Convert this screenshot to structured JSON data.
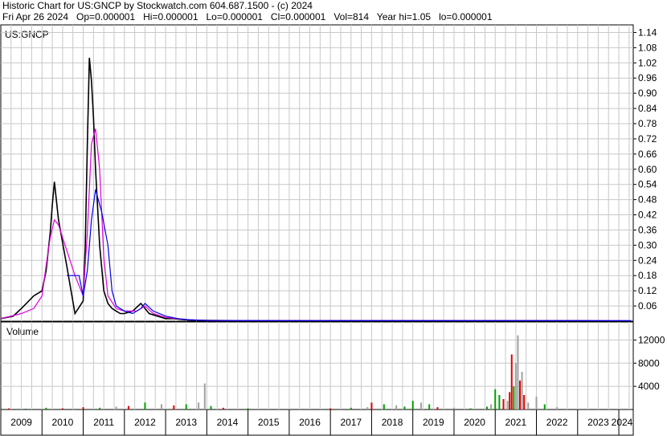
{
  "header": {
    "line1": "Historic Chart for US:GNCP by Stockwatch.com 604.687.1500 - (c) 2024",
    "line2": "Fri Apr 26 2024   Op=0.000001   Hi=0.000001   Lo=0.000001   Cl=0.000001   Vol=814   Year hi=1.05   lo=0.000001"
  },
  "colors": {
    "grid": "#c8c8c8",
    "price": "#000000",
    "down": "#e00000",
    "ma_short": "#e000e0",
    "ma_long": "#0000e0",
    "vol_up": "#00a000",
    "vol_down": "#e00000",
    "vol_flat": "#a0a0a0"
  },
  "chart_data": [
    {
      "type": "line",
      "title": "",
      "symbol_label": "US:GNCP",
      "ylim": [
        0,
        1.17
      ],
      "yticks": [
        "1.14",
        "1.08",
        "1.02",
        "0.96",
        "0.90",
        "0.84",
        "0.78",
        "0.72",
        "0.66",
        "0.60",
        "0.54",
        "0.48",
        "0.42",
        "0.36",
        "0.30",
        "0.24",
        "0.18",
        "0.12",
        "0.06"
      ],
      "x_years": [
        "2009",
        "2010",
        "2011",
        "2012",
        "2013",
        "2014",
        "2015",
        "2016",
        "2017",
        "2018",
        "2019",
        "2020",
        "2021",
        "2022",
        "2023",
        "2024"
      ],
      "series": [
        {
          "style": "price",
          "x": [
            2009.0,
            2009.3,
            2009.5,
            2009.8,
            2010.0,
            2010.1,
            2010.2,
            2010.25,
            2010.3,
            2010.4,
            2010.6,
            2010.8,
            2011.0,
            2011.05,
            2011.1,
            2011.15,
            2011.2,
            2011.25,
            2011.3,
            2011.4,
            2011.5,
            2011.6,
            2011.7,
            2011.8,
            2011.9,
            2012.0,
            2012.2,
            2012.4,
            2012.6,
            2012.8,
            2013.0,
            2013.2,
            2013.5,
            2014.0,
            2015.0,
            2016.0,
            2017.0,
            2018.0,
            2019.0,
            2020.0,
            2021.0,
            2021.5,
            2022.0,
            2023.0,
            2024.3
          ],
          "y": [
            0.01,
            0.02,
            0.05,
            0.1,
            0.12,
            0.2,
            0.35,
            0.46,
            0.55,
            0.4,
            0.22,
            0.03,
            0.08,
            0.3,
            0.7,
            1.04,
            0.95,
            0.8,
            0.6,
            0.3,
            0.12,
            0.07,
            0.05,
            0.04,
            0.03,
            0.03,
            0.04,
            0.07,
            0.03,
            0.02,
            0.01,
            0.01,
            0.005,
            0.003,
            0.002,
            0.002,
            0.002,
            0.002,
            0.002,
            0.002,
            0.002,
            0.002,
            0.002,
            0.002,
            1e-06
          ]
        },
        {
          "style": "ma_short",
          "x": [
            2009.0,
            2009.5,
            2009.8,
            2010.0,
            2010.1,
            2010.2,
            2010.3,
            2010.4,
            2010.6,
            2010.8,
            2011.0,
            2011.1,
            2011.2,
            2011.3,
            2011.4,
            2011.5,
            2011.6,
            2011.8,
            2012.0,
            2012.3,
            2012.5,
            2012.7,
            2013.0,
            2013.5,
            2014.0,
            2016.0,
            2020.0,
            2024.3
          ],
          "y": [
            0.01,
            0.03,
            0.05,
            0.1,
            0.22,
            0.33,
            0.4,
            0.38,
            0.28,
            0.18,
            0.1,
            0.35,
            0.7,
            0.76,
            0.6,
            0.25,
            0.1,
            0.05,
            0.04,
            0.04,
            0.06,
            0.03,
            0.015,
            0.006,
            0.003,
            0.002,
            0.002,
            0.002
          ]
        },
        {
          "style": "ma_long",
          "x": [
            2010.6,
            2010.9,
            2011.0,
            2011.1,
            2011.2,
            2011.3,
            2011.45,
            2011.6,
            2011.7,
            2011.8,
            2012.0,
            2012.2,
            2012.4,
            2012.5,
            2012.7,
            2013.0,
            2013.3,
            2013.6,
            2014.0,
            2016.0,
            2020.0,
            2024.3
          ],
          "y": [
            0.18,
            0.18,
            0.1,
            0.2,
            0.4,
            0.52,
            0.43,
            0.3,
            0.12,
            0.06,
            0.04,
            0.03,
            0.05,
            0.07,
            0.04,
            0.02,
            0.01,
            0.005,
            0.003,
            0.002,
            0.002,
            0.002
          ]
        }
      ]
    },
    {
      "type": "bar",
      "title": "Volume",
      "ylim": [
        0,
        14000
      ],
      "yticks": [
        "12000",
        "8000",
        "4000"
      ],
      "series": [
        {
          "name": "",
          "x": [
            2009.2,
            2009.6,
            2010.1,
            2010.5,
            2011.0,
            2011.4,
            2011.8,
            2012.1,
            2012.5,
            2012.9,
            2013.2,
            2013.5,
            2013.8,
            2013.95,
            2014.1,
            2014.4,
            2015.0,
            2016.0,
            2017.0,
            2017.5,
            2017.9,
            2018.0,
            2018.3,
            2018.6,
            2018.8,
            2019.0,
            2019.2,
            2019.4,
            2019.6,
            2020.0,
            2020.4,
            2020.8,
            2020.9,
            2021.0,
            2021.1,
            2021.2,
            2021.3,
            2021.35,
            2021.4,
            2021.45,
            2021.5,
            2021.55,
            2021.6,
            2021.65,
            2021.7,
            2021.8,
            2022.0,
            2022.2,
            2022.5
          ],
          "y": [
            200,
            150,
            300,
            200,
            400,
            300,
            500,
            600,
            1200,
            900,
            700,
            900,
            1200,
            4500,
            600,
            300,
            200,
            150,
            200,
            300,
            400,
            1200,
            900,
            700,
            500,
            1500,
            1200,
            900,
            400,
            300,
            200,
            500,
            900,
            3500,
            2500,
            1800,
            1500,
            3000,
            9500,
            4000,
            8000,
            12800,
            5000,
            6500,
            2500,
            1200,
            2200,
            900,
            400
          ],
          "colors": [
            "down",
            "up",
            "up",
            "down",
            "down",
            "up",
            "flat",
            "down",
            "up",
            "flat",
            "down",
            "up",
            "flat",
            "flat",
            "up",
            "down",
            "up",
            "flat",
            "down",
            "up",
            "flat",
            "down",
            "up",
            "flat",
            "up",
            "up",
            "flat",
            "up",
            "down",
            "flat",
            "up",
            "up",
            "flat",
            "up",
            "up",
            "down",
            "flat",
            "down",
            "down",
            "up",
            "flat",
            "flat",
            "down",
            "flat",
            "down",
            "flat",
            "flat",
            "up",
            "flat"
          ]
        }
      ]
    }
  ]
}
